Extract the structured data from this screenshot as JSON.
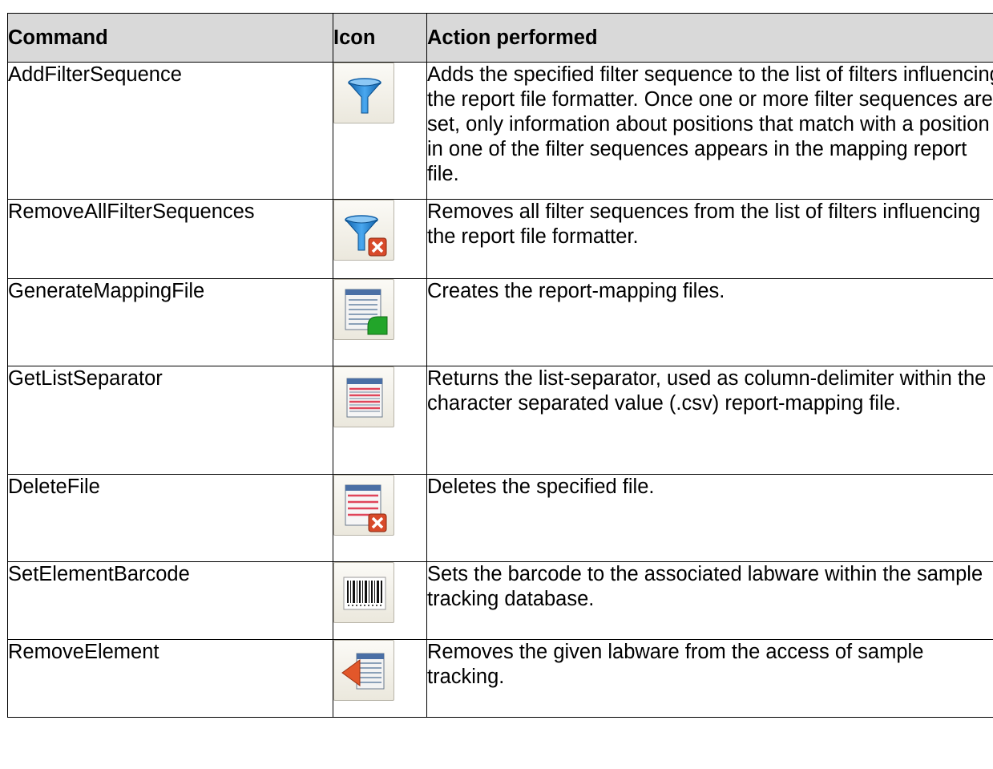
{
  "table": {
    "headers": [
      "Command",
      "Icon",
      "Action performed"
    ],
    "rows": [
      {
        "command": "AddFilterSequence",
        "icon": "filter-funnel-icon",
        "action": "Adds the specified filter sequence to the list of filters influencing the report file formatter. Once one or more filter sequences are set, only information about positions that match with a position in one of the filter sequences appears in the mapping report file."
      },
      {
        "command": "RemoveAllFilterSequences",
        "icon": "filter-remove-icon",
        "action": "Removes all filter sequences from the list of filters influencing the report file formatter."
      },
      {
        "command": "GenerateMappingFile",
        "icon": "generate-mapping-file-icon",
        "action": "Creates the report-mapping files."
      },
      {
        "command": "GetListSeparator",
        "icon": "list-separator-icon",
        "action": "Returns the list-separator, used as column-delimiter within the character separated value (.csv) report-mapping file."
      },
      {
        "command": "DeleteFile",
        "icon": "delete-file-icon",
        "action": "Deletes the specified file."
      },
      {
        "command": "SetElementBarcode",
        "icon": "barcode-icon",
        "action": "Sets the barcode to the associated labware within the sample tracking database."
      },
      {
        "command": "RemoveElement",
        "icon": "remove-element-icon",
        "action": "Removes the given labware from the access of sample tracking."
      }
    ]
  },
  "colors": {
    "header_bg": "#d9d9d9",
    "border": "#000000",
    "funnel_blue": "#1f7fd0",
    "delete_red": "#d84a2a",
    "green": "#22a52a"
  }
}
